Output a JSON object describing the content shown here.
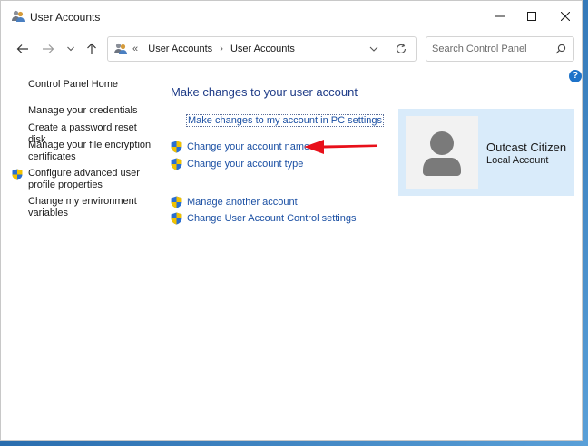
{
  "window": {
    "title": "User Accounts",
    "icon": "users-icon",
    "controls": [
      "minimize-icon",
      "maximize-icon",
      "close-icon"
    ]
  },
  "navigation": {
    "back_icon": "arrow-left-icon",
    "forward_icon": "arrow-right-icon",
    "recent_icon": "chevron-down-icon",
    "up_icon": "arrow-up-icon"
  },
  "address": {
    "overflow": "«",
    "crumbs": [
      "User Accounts",
      "User Accounts"
    ],
    "separator": "›"
  },
  "search": {
    "placeholder": "Search Control Panel",
    "value": ""
  },
  "help": {
    "label": "?"
  },
  "sidebar": {
    "home": "Control Panel Home",
    "items": [
      {
        "label": "Manage your credentials",
        "icon": null
      },
      {
        "label": "Create a password reset disk",
        "icon": null
      },
      {
        "label": "Manage your file encryption certificates",
        "icon": null
      },
      {
        "label": "Configure advanced user profile properties",
        "icon": "uac-shield-icon"
      },
      {
        "label": "Change my environment variables",
        "icon": null
      }
    ]
  },
  "main": {
    "heading": "Make changes to your user account",
    "pc_settings_link": "Make changes to my account in PC settings",
    "tasks": [
      {
        "label": "Change your account name",
        "icon": "uac-shield-icon"
      },
      {
        "label": "Change your account type",
        "icon": "uac-shield-icon"
      },
      {
        "label": "Manage another account",
        "icon": "uac-shield-icon"
      },
      {
        "label": "Change User Account Control settings",
        "icon": "uac-shield-icon"
      }
    ]
  },
  "account": {
    "name": "Outcast Citizen",
    "type": "Local Account",
    "avatar": "person-silhouette-icon"
  },
  "colors": {
    "link": "#1a4fa3",
    "heading": "#1e3b87",
    "account_panel": "#d9ebfa",
    "annotation_arrow": "#e8101a"
  }
}
